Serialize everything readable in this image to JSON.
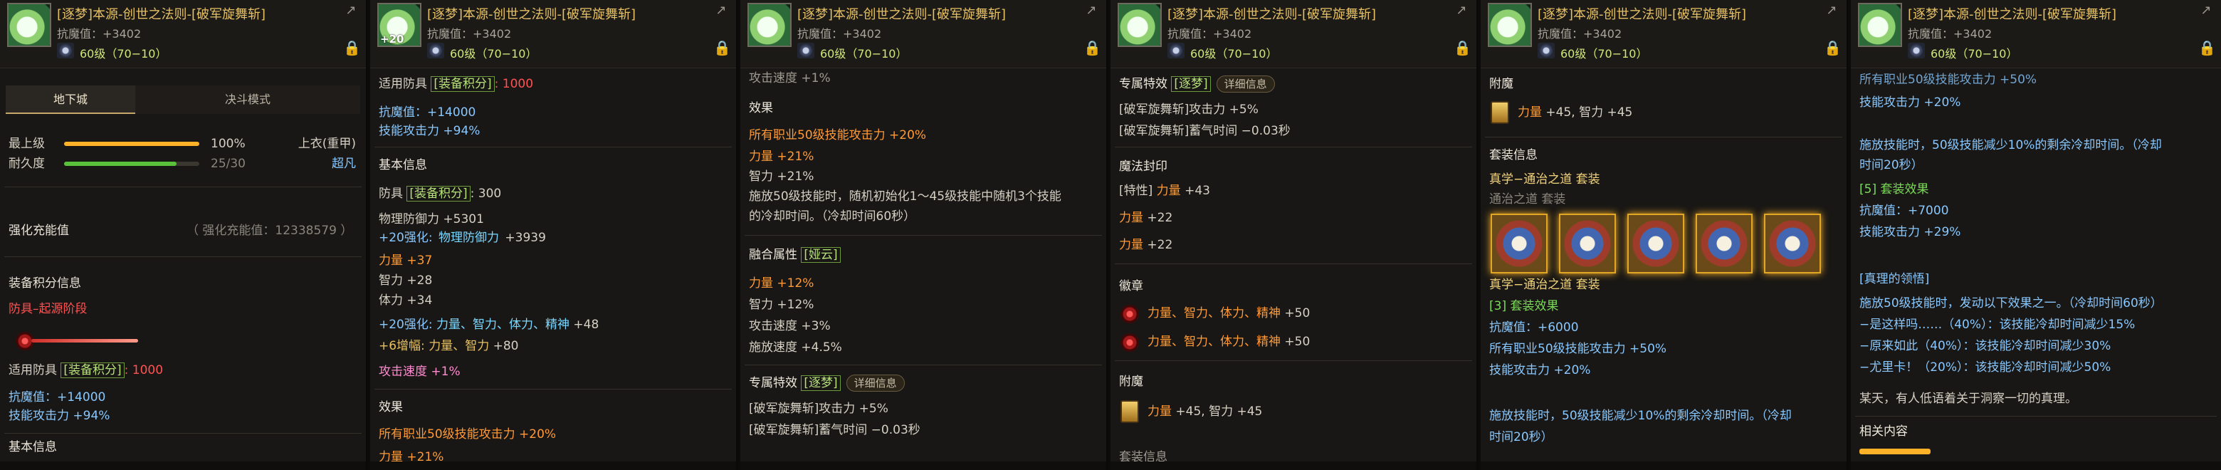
{
  "item": {
    "title": "[逐梦]本源-创世之法则-[破军旋舞斩]",
    "resist": "抗魔值：+3402",
    "level": "60级（70−10）",
    "icon_badge": "+20"
  },
  "icons": {
    "share": "share-icon",
    "lock": "lock-icon"
  },
  "p1": {
    "tab1": "地下城",
    "tab2": "决斗模式",
    "top_lv": "最上级",
    "top_pct": "100%",
    "dur": "耐久度",
    "dur_val": "25/30",
    "dur_fraction": 0.83,
    "slot": "上衣(重甲)",
    "grade": "超凡",
    "enhance": "强化充能值",
    "enhance_val": "（ 强化充能值：12338579 ）",
    "score_title": "装备积分信息",
    "score_stage": "防具–起源阶段",
    "score_pre": "适用防具",
    "score_box": "[装备积分]",
    "score_val": ": 1000",
    "resist": "抗魔值：+14000",
    "skill": "技能攻击力 +94%",
    "basic": "基本信息"
  },
  "p2": {
    "score_pre": "适用防具",
    "score_box": "[装备积分]",
    "score_val": ": 1000",
    "resist": "抗魔值：+14000",
    "skill": "技能攻击力 +94%",
    "basic": "基本信息",
    "armor_pre": "防具",
    "armor_box": "[装备积分]",
    "armor_val": ": 300",
    "phys_def": "物理防御力 +5301",
    "enh_def_pre": "+20强化:",
    "enh_def_mid": "物理防御力",
    "enh_def_val": " +3939",
    "str": "力量 +37",
    "int": "智力 +28",
    "vit": "体力 +34",
    "enh_pre": "+20强化:",
    "enh_mid": "力量、智力、体力、精神",
    "enh_val": " +48",
    "amp_pre": "+6增幅:",
    "amp_mid": "力量、智力",
    "amp_val": " +80",
    "atk_spd": "攻击速度 +1%",
    "effect": "效果",
    "eff_line_a": "所有职业",
    "eff_line_b": "50级技能攻击力",
    "eff_line_c": " +20%",
    "cut": "力量 +21%"
  },
  "p3": {
    "cut": "攻击速度 +1%",
    "effect": "效果",
    "eff_a": "所有职业",
    "eff_b": "50级技能攻击力",
    "eff_c": " +20%",
    "str": "力量 +21%",
    "int": "智力 +21%",
    "desc1": "施放50级技能时，随机初始化1～45级技能中随机3个技能",
    "desc2": "的冷却时间。（冷却时间60秒）",
    "fuse": "融合属性",
    "fuse_box": "[娅云]",
    "f_str": "力量 +12%",
    "f_int": "智力 +12%",
    "f_atk": "攻击速度 +3%",
    "f_cast": "施放速度 +4.5%",
    "excl": "专属特效",
    "excl_box": "[逐梦]",
    "detail": "详细信息",
    "e1": "[破军旋舞斩]攻击力 +5%",
    "e2": "[破军旋舞斩]蓄气时间 −0.03秒"
  },
  "p4": {
    "excl": "专属特效",
    "excl_box": "[逐梦]",
    "detail": "详细信息",
    "e1": "[破军旋舞斩]攻击力 +5%",
    "e2": "[破军旋舞斩]蓄气时间 −0.03秒",
    "seal": "魔法封印",
    "s1a": "[特性]",
    "s1b": "力量",
    "s1c": " +43",
    "s2a": "力量",
    "s2b": " +22",
    "s3a": "力量",
    "s3b": " +22",
    "emblem": "徽章",
    "em1a": "力量、智力、体力、精神",
    "em1b": " +50",
    "em2a": "力量、智力、体力、精神",
    "em2b": " +50",
    "enchant": "附魔",
    "ench_a": "力量",
    "ench_b": " +45, 智力 +45",
    "cut": "套装信息"
  },
  "p5": {
    "enchant": "附魔",
    "ench_a": "力量",
    "ench_b": " +45, 智力 +45",
    "set": "套装信息",
    "set_name": "真学−通治之道 套装",
    "set_parts": "通治之道 套装",
    "set_name2": "真学−通治之道 套装",
    "set_eff": "[3] 套装效果",
    "resist": "抗魔值：+6000",
    "eff_a": "所有职业",
    "eff_b": "50级技能攻击力",
    "eff_c": " +50%",
    "skill": "技能攻击力 +20%",
    "desc1": "施放技能时，50级技能减少10%的剩余冷却时间。（冷却",
    "desc2": "时间20秒）"
  },
  "p6": {
    "cut": "所有职业50级技能攻击力 +50%",
    "skill": "技能攻击力 +20%",
    "desc1": "施放技能时，50级技能减少10%的剩余冷却时间。（冷却",
    "desc2": "时间20秒）",
    "set5": "[5] 套装效果",
    "resist": "抗魔值：+7000",
    "skill2": "技能攻击力 +29%",
    "realm": "[真理的领悟]",
    "d1": "施放50级技能时，发动以下效果之一。（冷却时间60秒）",
    "d2": "−是这样吗……（40%）：该技能冷却时间减少15%",
    "d3": "−原来如此（40%）：该技能冷却时间减少30%",
    "d4": "−尤里卡！（20%）：该技能冷却时间减少50%",
    "flavor": "某天，有人低语着关于洞察一切的真理。",
    "related": "相关内容"
  }
}
